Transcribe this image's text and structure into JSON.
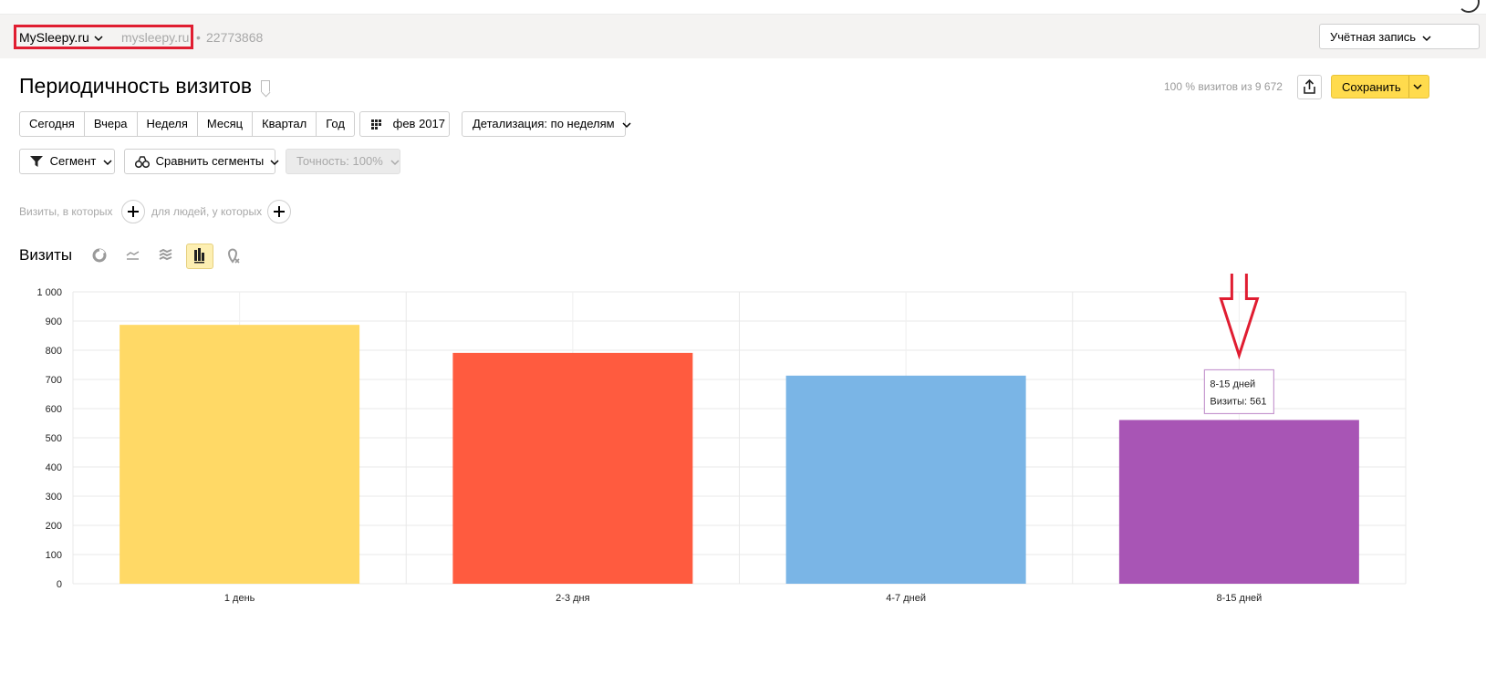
{
  "breadcrumb": {
    "site_name": "MySleepy.ru",
    "site_domain": "mysleepy.ru",
    "site_id": "22773868"
  },
  "account": {
    "label": "Учётная запись"
  },
  "report": {
    "title": "Периодичность визитов",
    "sample_info": "100 % визитов из 9 672",
    "save_label": "Сохранить"
  },
  "period_tabs": [
    "Сегодня",
    "Вчера",
    "Неделя",
    "Месяц",
    "Квартал",
    "Год"
  ],
  "date_range": "фев 2017",
  "detail": "Детализация: по неделям",
  "segment": "Сегмент",
  "compare_segments": "Сравнить сегменты",
  "accuracy": "Точность: 100%",
  "conditions": {
    "visits_label": "Визиты, в которых",
    "people_label": "для людей, у которых"
  },
  "chart_header": {
    "title": "Визиты"
  },
  "icons": {
    "view_pie": "pie-chart-icon",
    "view_line": "line-chart-icon",
    "view_area": "area-chart-icon",
    "view_bar": "bar-chart-icon",
    "view_map": "map-pin-icon"
  },
  "chart_data": {
    "type": "bar",
    "categories": [
      "1 день",
      "2-3 дня",
      "4-7 дней",
      "8-15 дней"
    ],
    "values": [
      887,
      791,
      713,
      561
    ],
    "colors": [
      "#ffd966",
      "#ff5b3f",
      "#7ab5e6",
      "#a855b5"
    ],
    "ylim": [
      0,
      1000
    ],
    "yticks": [
      0,
      100,
      200,
      300,
      400,
      500,
      600,
      700,
      800,
      900,
      1000
    ],
    "ytick_labels": [
      "0",
      "100",
      "200",
      "300",
      "400",
      "500",
      "600",
      "700",
      "800",
      "900",
      "1 000"
    ],
    "grid": true,
    "tooltip": {
      "category": "8-15 дней",
      "label": "Визиты: 561"
    }
  }
}
